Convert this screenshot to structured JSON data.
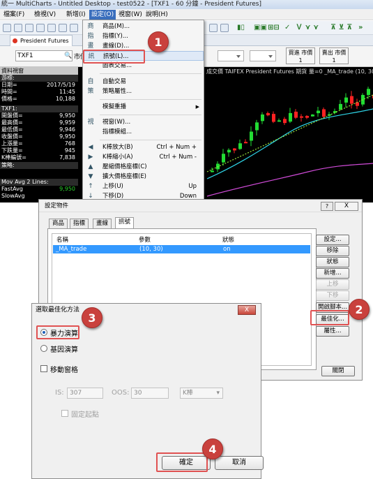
{
  "window": {
    "title": "統一 MultiCharts - Untitled Desktop - test0522 - [TXF1 - 60 分鐘 - President Futures]"
  },
  "menubar": [
    "檔案(F)",
    "檢視(V)",
    "新增(I)",
    "設定(O)",
    "視窗(W)",
    "說明(H)"
  ],
  "doc_tab": "President Futures",
  "quote_bar": {
    "symbol": "TXF1",
    "market_label": "市價",
    "buy_button": [
      "買進 市價",
      "1"
    ],
    "sell_button": [
      "賣出 市價",
      "1"
    ]
  },
  "quote_panel": {
    "header": "資料視窗",
    "rows": [
      {
        "label": "游標:",
        "value": ""
      },
      {
        "label": "日期=",
        "value": "2017/5/19"
      },
      {
        "label": "時間=",
        "value": "11:45"
      },
      {
        "label": "價格=",
        "value": "10,188"
      },
      {
        "label": "TXF1:",
        "value": ""
      },
      {
        "label": "開盤價=",
        "value": "9,950"
      },
      {
        "label": "最高價=",
        "value": "9,959"
      },
      {
        "label": "最低價=",
        "value": "9,946"
      },
      {
        "label": "收盤價=",
        "value": "9,950"
      },
      {
        "label": "上漲量=",
        "value": "768"
      },
      {
        "label": "下跌量=",
        "value": "945"
      },
      {
        "label": "K棒編號=",
        "value": "7,838"
      },
      {
        "label": "策略:",
        "value": ""
      },
      {
        "label": "Mov Avg 2 Lines:",
        "value": ""
      },
      {
        "label": "FastAvg",
        "value": "9,950"
      },
      {
        "label": "SlowAvg",
        "value": ""
      }
    ]
  },
  "chart": {
    "caption": "成交價  TAIFEX  President Futures  期貨  量=0  _MA_trade (10, 30, 80"
  },
  "settings_menu": {
    "items": [
      {
        "icon": "商",
        "label": "商品(M)...",
        "shortcut": ""
      },
      {
        "icon": "指",
        "label": "指標(Y)...",
        "shortcut": ""
      },
      {
        "icon": "畫",
        "label": "畫線(D)...",
        "shortcut": ""
      },
      {
        "icon": "訊",
        "label": "訊號(L)...",
        "shortcut": ""
      },
      {
        "icon": "",
        "label": "圖表交易...",
        "shortcut": ""
      },
      {
        "icon": "自",
        "label": "自動交易",
        "shortcut": ""
      },
      {
        "icon": "策",
        "label": "策略屬性...",
        "shortcut": ""
      },
      {
        "icon": "",
        "label": "模擬重播",
        "shortcut": ""
      },
      {
        "icon": "視",
        "label": "視窗(W)...",
        "shortcut": ""
      },
      {
        "icon": "",
        "label": "指標模組...",
        "shortcut": ""
      },
      {
        "icon": "◀",
        "label": "K棒放大(B)",
        "shortcut": "Ctrl + Num +"
      },
      {
        "icon": "▶",
        "label": "K棒縮小(A)",
        "shortcut": "Ctrl + Num -"
      },
      {
        "icon": "▲",
        "label": "壓縮價格座標(C)",
        "shortcut": ""
      },
      {
        "icon": "▼",
        "label": "擴大價格座標(E)",
        "shortcut": ""
      },
      {
        "icon": "↑",
        "label": "上移(U)",
        "shortcut": "Up"
      },
      {
        "icon": "↓",
        "label": "下移(D)",
        "shortcut": "Down"
      }
    ]
  },
  "settings_dialog": {
    "title": "設定物件",
    "help": "?",
    "close": "X",
    "tabs": [
      "商品",
      "指標",
      "畫線",
      "訊號"
    ],
    "columns": [
      "名稱",
      "參數",
      "狀態"
    ],
    "rows": [
      {
        "name": "_MA_trade",
        "params": "(10, 30)",
        "status": "on"
      }
    ],
    "buttons": [
      "設定...",
      "移除",
      "狀態",
      "新增...",
      "上移",
      "下移",
      "開啟腳本...",
      "最佳化...",
      "屬性...",
      "關閉"
    ]
  },
  "optimization_dialog": {
    "title": "選取最佳化方法",
    "close": "X",
    "options": [
      "暴力演算",
      "基因演算"
    ],
    "walk_forward": "移動窗格",
    "is_label": "IS:",
    "is_value": "307",
    "oos_label": "OOS:",
    "oos_value": "30",
    "unit": "K棒",
    "anchored": "固定起點",
    "ok": "確定",
    "cancel": "取消"
  },
  "badges": [
    "1",
    "2",
    "3",
    "4"
  ]
}
